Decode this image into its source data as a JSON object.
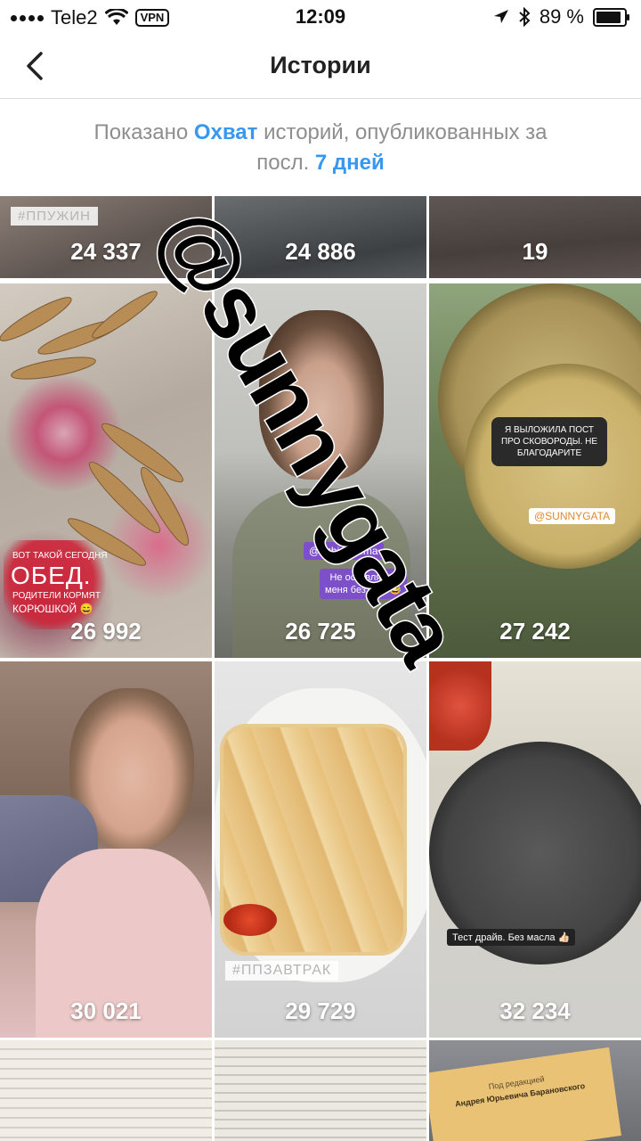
{
  "status_bar": {
    "carrier": "Tele2",
    "vpn": "VPN",
    "time": "12:09",
    "battery": "89 %",
    "battery_level": 0.89
  },
  "nav": {
    "title": "Истории",
    "back_icon": "chevron-left-icon"
  },
  "info": {
    "prefix": "Показано",
    "metric": "Охват",
    "middle": "историй, опубликованных за",
    "period_prefix": "посл.",
    "period": "7 дней"
  },
  "stories": [
    {
      "count": "24 337",
      "tag": "#ППУЖИН"
    },
    {
      "count": "24 886"
    },
    {
      "count": "19"
    },
    {
      "count": "26 992",
      "caption_top": "ВОТ ТАКОЙ СЕГОДНЯ",
      "caption_main": "ОБЕД.",
      "caption_sub1": "РОДИТЕЛИ КОРМЯТ",
      "caption_sub2": "КОРЮШКОЙ 😄"
    },
    {
      "count": "26 725",
      "mention": "@uzhin_doma",
      "sticker_line1": "Не оставляйте",
      "sticker_line2": "меня без еды 😂"
    },
    {
      "count": "27 242",
      "bubble_line1": "Я ВЫЛОЖИЛА ПОСТ",
      "bubble_line2": "ПРО СКОВОРОДЫ. НЕ",
      "bubble_line3": "БЛАГОДАРИТЕ",
      "mention": "@SUNNYGATA"
    },
    {
      "count": "30 021"
    },
    {
      "count": "29 729",
      "tag": "#ППЗАВТРАК"
    },
    {
      "count": "32 234",
      "caption": "Тест драйв. Без масла 👍🏻"
    },
    {
      "count": ""
    },
    {
      "count": ""
    },
    {
      "count": "",
      "book_text1": "Под редакцией",
      "book_text2": "Андрея Юрьевича Барановского"
    }
  ],
  "watermark": "@sunnygata",
  "colors": {
    "accent": "#3897f0",
    "muted": "#8e8e8e"
  }
}
